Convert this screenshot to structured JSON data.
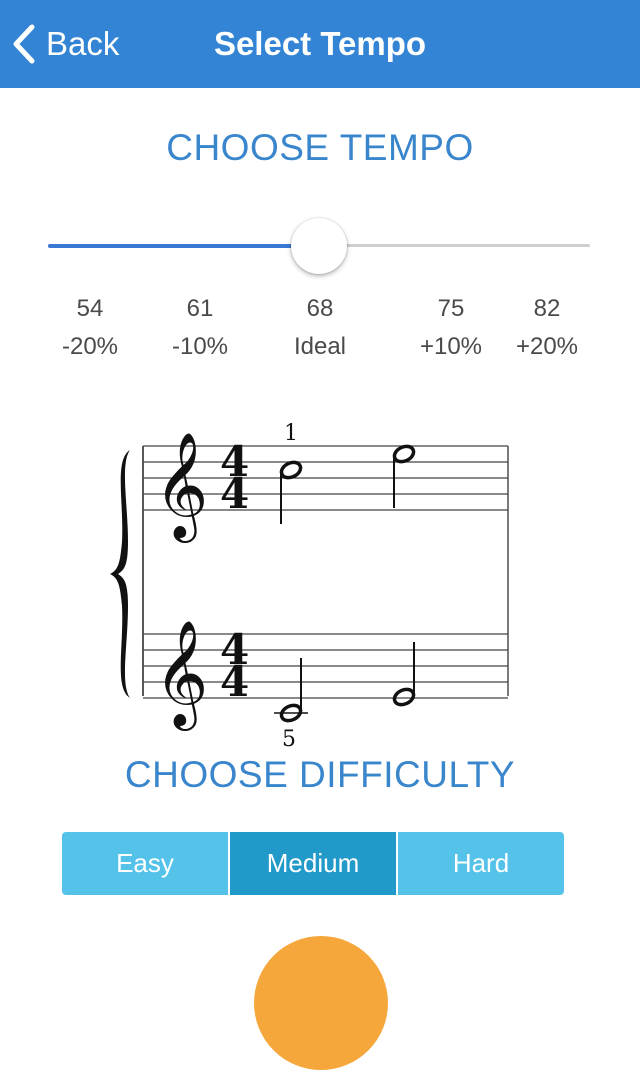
{
  "nav": {
    "back_label": "Back",
    "title": "Select Tempo",
    "bar_color": "#3384d4"
  },
  "tempo": {
    "section_title": "CHOOSE TEMPO",
    "selected_index": 2,
    "slider_fraction": 0.5,
    "marks": [
      {
        "bpm": "54",
        "pct": "-20%"
      },
      {
        "bpm": "61",
        "pct": "-10%"
      },
      {
        "bpm": "68",
        "pct": "Ideal"
      },
      {
        "bpm": "75",
        "pct": "+10%"
      },
      {
        "bpm": "82",
        "pct": "+20%"
      }
    ]
  },
  "score": {
    "time_signature": {
      "top": "4",
      "bottom": "4"
    },
    "treble_fingering": "1",
    "bass_fingering": "5"
  },
  "difficulty": {
    "section_title": "CHOOSE DIFFICULTY",
    "options": [
      "Easy",
      "Medium",
      "Hard"
    ],
    "selected": "Medium",
    "color": "#54c2e9",
    "selected_color": "#2199c9"
  },
  "play_button": {
    "color": "#f5a73b"
  }
}
